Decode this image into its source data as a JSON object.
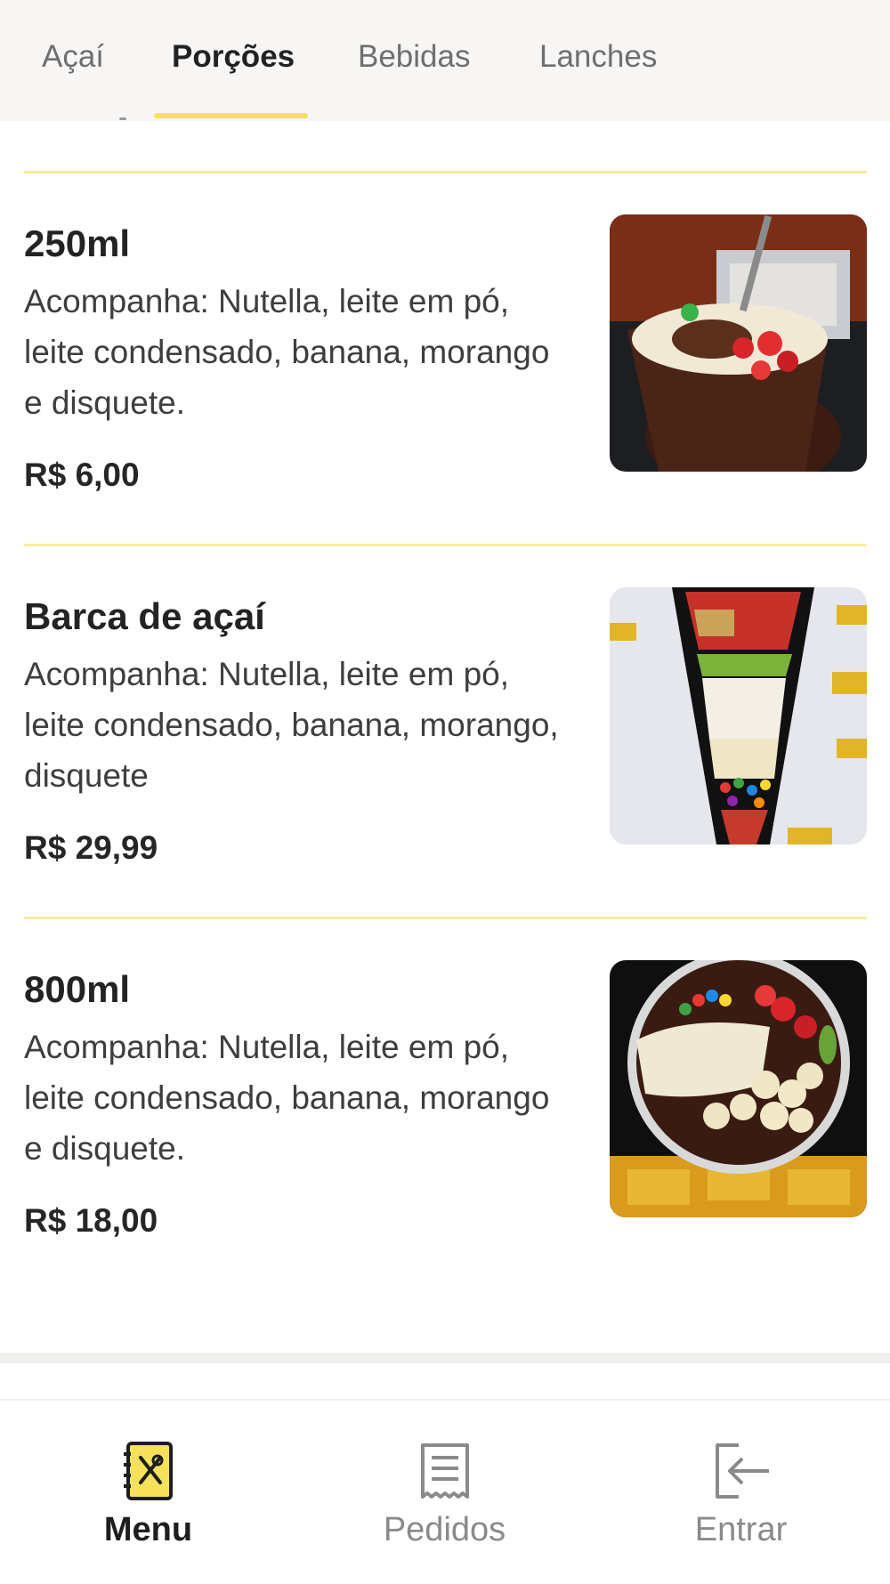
{
  "tabs": [
    {
      "label": "Açaí"
    },
    {
      "label": "Porções"
    },
    {
      "label": "Bebidas"
    },
    {
      "label": "Lanches"
    }
  ],
  "active_tab": "Porções",
  "products": [
    {
      "title": "250ml",
      "description": "Acompanha: Nutella, leite em pó, leite condensado, banana, morango e disquete.",
      "price": "R$ 6,00"
    },
    {
      "title": "Barca de açaí",
      "description": "Acompanha: Nutella, leite em pó, leite condensado, banana, morango, disquete",
      "price": "R$ 29,99"
    },
    {
      "title": "800ml",
      "description": "Acompanha: Nutella, leite em pó, leite condensado, banana, morango e disquete.",
      "price": "R$ 18,00"
    }
  ],
  "bottom_nav": [
    {
      "label": "Menu",
      "icon": "menu-book-icon"
    },
    {
      "label": "Pedidos",
      "icon": "receipt-icon"
    },
    {
      "label": "Entrar",
      "icon": "login-icon"
    }
  ],
  "colors": {
    "accent": "#f6e15a",
    "divider": "#f8ec9f",
    "tabbar_bg": "#f7f6f4"
  }
}
